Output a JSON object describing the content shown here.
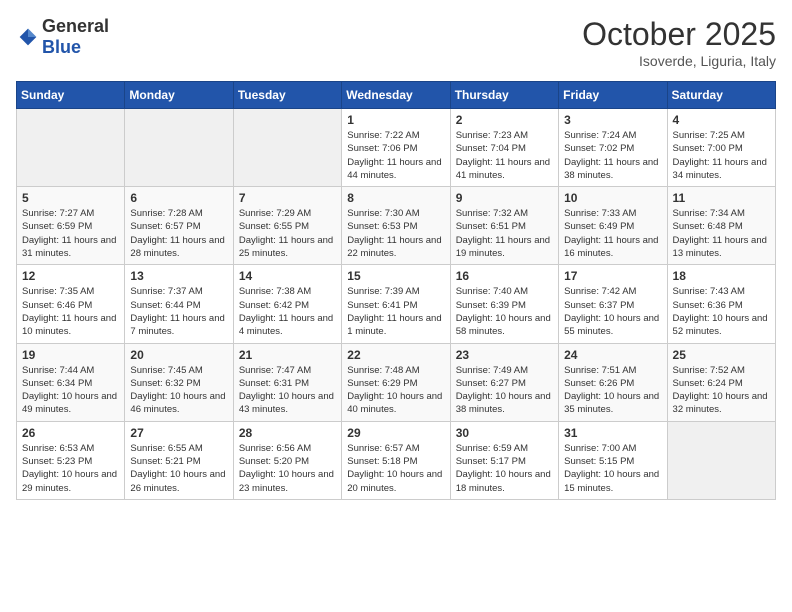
{
  "logo": {
    "general": "General",
    "blue": "Blue"
  },
  "header": {
    "month": "October 2025",
    "location": "Isoverde, Liguria, Italy"
  },
  "weekdays": [
    "Sunday",
    "Monday",
    "Tuesday",
    "Wednesday",
    "Thursday",
    "Friday",
    "Saturday"
  ],
  "weeks": [
    [
      {
        "day": "",
        "info": ""
      },
      {
        "day": "",
        "info": ""
      },
      {
        "day": "",
        "info": ""
      },
      {
        "day": "1",
        "info": "Sunrise: 7:22 AM\nSunset: 7:06 PM\nDaylight: 11 hours\nand 44 minutes."
      },
      {
        "day": "2",
        "info": "Sunrise: 7:23 AM\nSunset: 7:04 PM\nDaylight: 11 hours\nand 41 minutes."
      },
      {
        "day": "3",
        "info": "Sunrise: 7:24 AM\nSunset: 7:02 PM\nDaylight: 11 hours\nand 38 minutes."
      },
      {
        "day": "4",
        "info": "Sunrise: 7:25 AM\nSunset: 7:00 PM\nDaylight: 11 hours\nand 34 minutes."
      }
    ],
    [
      {
        "day": "5",
        "info": "Sunrise: 7:27 AM\nSunset: 6:59 PM\nDaylight: 11 hours\nand 31 minutes."
      },
      {
        "day": "6",
        "info": "Sunrise: 7:28 AM\nSunset: 6:57 PM\nDaylight: 11 hours\nand 28 minutes."
      },
      {
        "day": "7",
        "info": "Sunrise: 7:29 AM\nSunset: 6:55 PM\nDaylight: 11 hours\nand 25 minutes."
      },
      {
        "day": "8",
        "info": "Sunrise: 7:30 AM\nSunset: 6:53 PM\nDaylight: 11 hours\nand 22 minutes."
      },
      {
        "day": "9",
        "info": "Sunrise: 7:32 AM\nSunset: 6:51 PM\nDaylight: 11 hours\nand 19 minutes."
      },
      {
        "day": "10",
        "info": "Sunrise: 7:33 AM\nSunset: 6:49 PM\nDaylight: 11 hours\nand 16 minutes."
      },
      {
        "day": "11",
        "info": "Sunrise: 7:34 AM\nSunset: 6:48 PM\nDaylight: 11 hours\nand 13 minutes."
      }
    ],
    [
      {
        "day": "12",
        "info": "Sunrise: 7:35 AM\nSunset: 6:46 PM\nDaylight: 11 hours\nand 10 minutes."
      },
      {
        "day": "13",
        "info": "Sunrise: 7:37 AM\nSunset: 6:44 PM\nDaylight: 11 hours\nand 7 minutes."
      },
      {
        "day": "14",
        "info": "Sunrise: 7:38 AM\nSunset: 6:42 PM\nDaylight: 11 hours\nand 4 minutes."
      },
      {
        "day": "15",
        "info": "Sunrise: 7:39 AM\nSunset: 6:41 PM\nDaylight: 11 hours\nand 1 minute."
      },
      {
        "day": "16",
        "info": "Sunrise: 7:40 AM\nSunset: 6:39 PM\nDaylight: 10 hours\nand 58 minutes."
      },
      {
        "day": "17",
        "info": "Sunrise: 7:42 AM\nSunset: 6:37 PM\nDaylight: 10 hours\nand 55 minutes."
      },
      {
        "day": "18",
        "info": "Sunrise: 7:43 AM\nSunset: 6:36 PM\nDaylight: 10 hours\nand 52 minutes."
      }
    ],
    [
      {
        "day": "19",
        "info": "Sunrise: 7:44 AM\nSunset: 6:34 PM\nDaylight: 10 hours\nand 49 minutes."
      },
      {
        "day": "20",
        "info": "Sunrise: 7:45 AM\nSunset: 6:32 PM\nDaylight: 10 hours\nand 46 minutes."
      },
      {
        "day": "21",
        "info": "Sunrise: 7:47 AM\nSunset: 6:31 PM\nDaylight: 10 hours\nand 43 minutes."
      },
      {
        "day": "22",
        "info": "Sunrise: 7:48 AM\nSunset: 6:29 PM\nDaylight: 10 hours\nand 40 minutes."
      },
      {
        "day": "23",
        "info": "Sunrise: 7:49 AM\nSunset: 6:27 PM\nDaylight: 10 hours\nand 38 minutes."
      },
      {
        "day": "24",
        "info": "Sunrise: 7:51 AM\nSunset: 6:26 PM\nDaylight: 10 hours\nand 35 minutes."
      },
      {
        "day": "25",
        "info": "Sunrise: 7:52 AM\nSunset: 6:24 PM\nDaylight: 10 hours\nand 32 minutes."
      }
    ],
    [
      {
        "day": "26",
        "info": "Sunrise: 6:53 AM\nSunset: 5:23 PM\nDaylight: 10 hours\nand 29 minutes."
      },
      {
        "day": "27",
        "info": "Sunrise: 6:55 AM\nSunset: 5:21 PM\nDaylight: 10 hours\nand 26 minutes."
      },
      {
        "day": "28",
        "info": "Sunrise: 6:56 AM\nSunset: 5:20 PM\nDaylight: 10 hours\nand 23 minutes."
      },
      {
        "day": "29",
        "info": "Sunrise: 6:57 AM\nSunset: 5:18 PM\nDaylight: 10 hours\nand 20 minutes."
      },
      {
        "day": "30",
        "info": "Sunrise: 6:59 AM\nSunset: 5:17 PM\nDaylight: 10 hours\nand 18 minutes."
      },
      {
        "day": "31",
        "info": "Sunrise: 7:00 AM\nSunset: 5:15 PM\nDaylight: 10 hours\nand 15 minutes."
      },
      {
        "day": "",
        "info": ""
      }
    ]
  ]
}
